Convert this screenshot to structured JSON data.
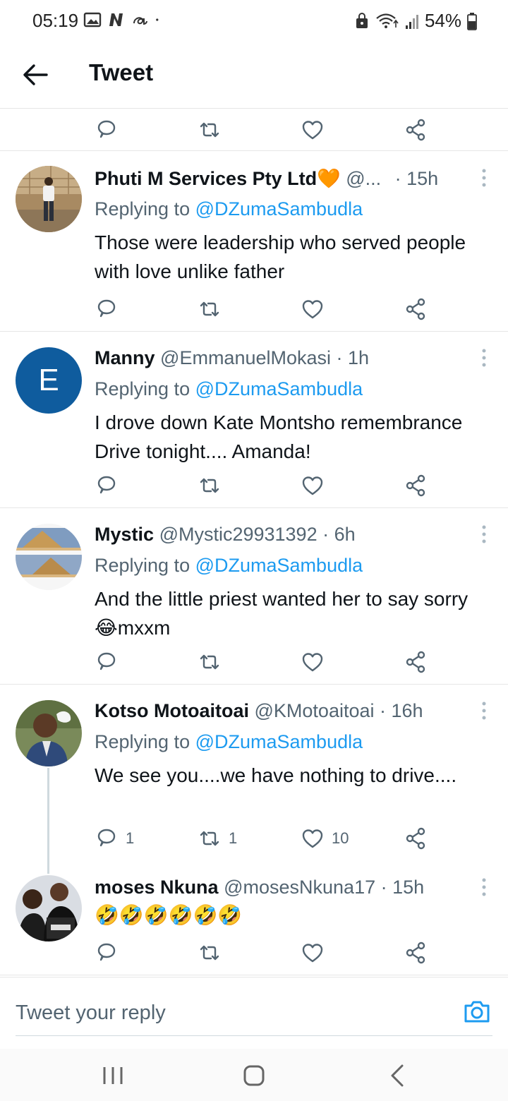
{
  "status": {
    "time": "05:19",
    "battery": "54%"
  },
  "header": {
    "title": "Tweet"
  },
  "tweets": [
    {
      "name": "Phuti M Services Pty Ltd🧡",
      "handle": "@...",
      "time": "· 15h",
      "replying_label": "Replying to",
      "replying_to": "@DZumaSambudla",
      "text": "Those were leadership who served people with love unlike father",
      "replies": "",
      "retweets": "",
      "likes": "",
      "avatar": "person-standing-photo"
    },
    {
      "name": "Manny",
      "handle": "@EmmanuelMokasi",
      "time": "· 1h",
      "replying_label": "Replying to",
      "replying_to": "@DZumaSambudla",
      "text": "I drove down Kate Montsho remembrance Drive tonight.... Amanda!",
      "replies": "",
      "retweets": "",
      "likes": "",
      "avatar_letter": "E",
      "avatar_color": "#0f5c9e"
    },
    {
      "name": "Mystic",
      "handle": "@Mystic29931392",
      "time": "· 6h",
      "replying_label": "Replying to",
      "replying_to": "@DZumaSambudla",
      "text": "And the little priest wanted her to say sorry😂mxxm",
      "replies": "",
      "retweets": "",
      "likes": "",
      "avatar": "pyramids-image"
    },
    {
      "name": "Kotso Motoaitoai",
      "handle": "@KMotoaitoai",
      "time": "· 16h",
      "replying_label": "Replying to",
      "replying_to": "@DZumaSambudla",
      "text": "We see you....we have nothing to drive....",
      "replies": "1",
      "retweets": "1",
      "likes": "10",
      "avatar": "man-with-handkerchief-photo"
    },
    {
      "name": "moses Nkuna",
      "handle": "@mosesNkuna17",
      "time": "· 15h",
      "replying_label": "",
      "replying_to": "",
      "text": "🤣🤣🤣🤣🤣🤣",
      "replies": "",
      "retweets": "",
      "likes": "",
      "avatar": "couple-photo"
    }
  ],
  "reply_box": {
    "placeholder": "Tweet your reply"
  },
  "colors": {
    "accent": "#1d9bf0",
    "secondary_text": "#536471",
    "divider": "#e6e6e6"
  }
}
